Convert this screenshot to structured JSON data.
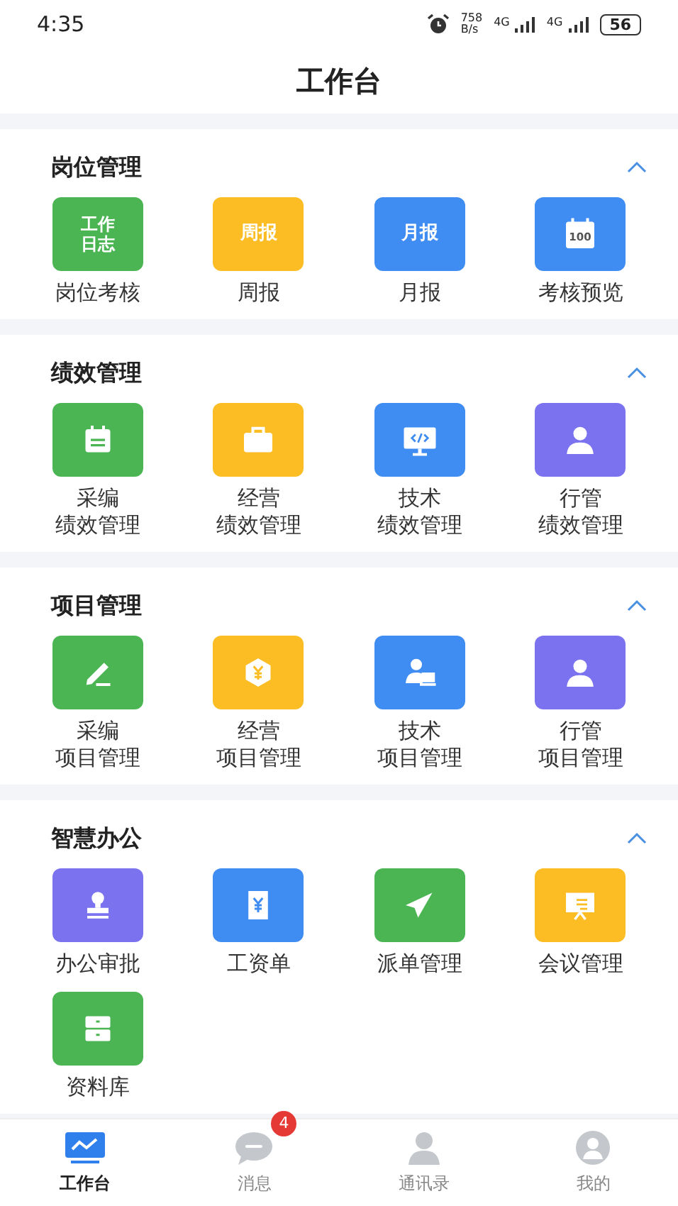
{
  "status_bar": {
    "time": "4:35",
    "speed_value": "758",
    "speed_unit": "B/s",
    "networks": [
      "4G",
      "4G"
    ],
    "battery": "56"
  },
  "title": "工作台",
  "sections": [
    {
      "title": "岗位管理",
      "expanded": true,
      "items": [
        {
          "label": [
            "岗位考核"
          ],
          "kind": "text",
          "icon_text": "工作日志",
          "color": "#4cb553"
        },
        {
          "label": [
            "周报"
          ],
          "kind": "text",
          "icon_text": "周报",
          "color": "#fbbd23"
        },
        {
          "label": [
            "月报"
          ],
          "kind": "text",
          "icon_text": "月报",
          "color": "#3f8cf2"
        },
        {
          "label": [
            "考核预览"
          ],
          "kind": "calendar",
          "icon_text": "100",
          "color": "#3f8cf2"
        }
      ]
    },
    {
      "title": "绩效管理",
      "expanded": true,
      "items": [
        {
          "label": [
            "采编",
            "绩效管理"
          ],
          "kind": "notepad",
          "color": "#4cb553"
        },
        {
          "label": [
            "经营",
            "绩效管理"
          ],
          "kind": "briefcase",
          "color": "#fbbd23"
        },
        {
          "label": [
            "技术",
            "绩效管理"
          ],
          "kind": "monitor",
          "color": "#3f8cf2"
        },
        {
          "label": [
            "行管",
            "绩效管理"
          ],
          "kind": "person",
          "color": "#7b72ef"
        }
      ]
    },
    {
      "title": "项目管理",
      "expanded": true,
      "items": [
        {
          "label": [
            "采编",
            "项目管理"
          ],
          "kind": "pencil",
          "color": "#4cb553"
        },
        {
          "label": [
            "经营",
            "项目管理"
          ],
          "kind": "coin",
          "color": "#fbbd23"
        },
        {
          "label": [
            "技术",
            "项目管理"
          ],
          "kind": "laptop",
          "color": "#3f8cf2"
        },
        {
          "label": [
            "行管",
            "项目管理"
          ],
          "kind": "person",
          "color": "#7b72ef"
        }
      ]
    },
    {
      "title": "智慧办公",
      "expanded": true,
      "items": [
        {
          "label": [
            "办公审批"
          ],
          "kind": "stamp",
          "color": "#7b72ef"
        },
        {
          "label": [
            "工资单"
          ],
          "kind": "receipt",
          "color": "#3f8cf2"
        },
        {
          "label": [
            "派单管理"
          ],
          "kind": "plane",
          "color": "#4cb553"
        },
        {
          "label": [
            "会议管理"
          ],
          "kind": "board",
          "color": "#fbbd23"
        },
        {
          "label": [
            "资料库"
          ],
          "kind": "cabinet",
          "color": "#4cb553"
        }
      ]
    }
  ],
  "tabs": [
    {
      "label": "工作台",
      "kind": "chart",
      "selected": true
    },
    {
      "label": "消息",
      "kind": "chat",
      "selected": false,
      "badge": "4"
    },
    {
      "label": "通讯录",
      "kind": "contacts",
      "selected": false
    },
    {
      "label": "我的",
      "kind": "user",
      "selected": false
    }
  ]
}
